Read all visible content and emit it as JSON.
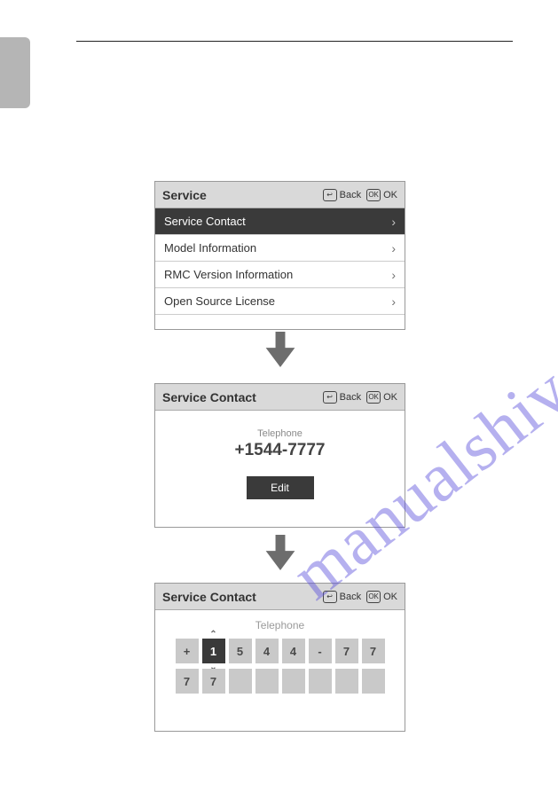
{
  "watermark": "manualshive.com",
  "panel1": {
    "title": "Service",
    "back": "Back",
    "ok": "OK",
    "items": [
      {
        "label": "Service Contact",
        "selected": true
      },
      {
        "label": "Model Information",
        "selected": false
      },
      {
        "label": "RMC Version Information",
        "selected": false
      },
      {
        "label": "Open Source License",
        "selected": false
      }
    ]
  },
  "panel2": {
    "title": "Service Contact",
    "back": "Back",
    "ok": "OK",
    "telLabel": "Telephone",
    "telNumber": "+1544-7777",
    "editLabel": "Edit"
  },
  "panel3": {
    "title": "Service Contact",
    "back": "Back",
    "ok": "OK",
    "telLabel": "Telephone",
    "row1": [
      "+",
      "1",
      "5",
      "4",
      "4",
      "-",
      "7",
      "7"
    ],
    "row1Selected": 1,
    "row2": [
      "7",
      "7",
      "",
      "",
      "",
      "",
      "",
      ""
    ]
  }
}
